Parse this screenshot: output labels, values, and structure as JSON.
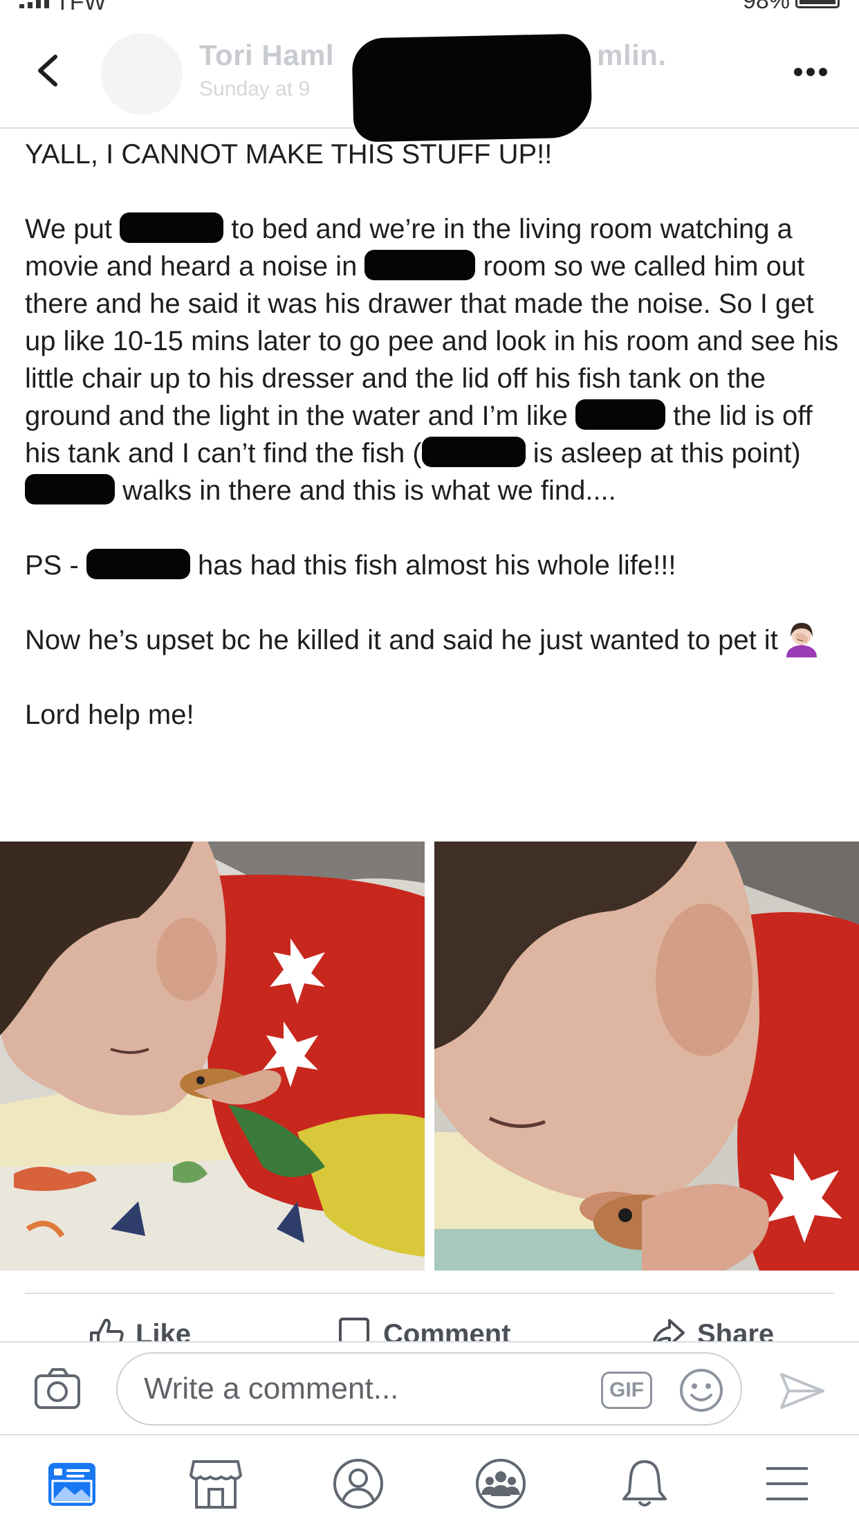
{
  "status_bar": {
    "carrier": "TFW",
    "battery": "98%"
  },
  "header": {
    "author": "Tori Haml",
    "author_suffix": "mlin.",
    "timestamp": "Sunday at 9"
  },
  "post": {
    "p1": "YALL, I CANNOT MAKE THIS STUFF UP!!",
    "p2_a": "We put ",
    "p2_b": " to bed and we’re in the living room watching a movie and heard a noise in ",
    "p2_c": " room so we called him out there and he said it was his drawer that made the noise. So I get up like 10-15 mins later to go pee and look in his room and see his little chair up to his dresser and the lid off his fish tank on the ground and the light in the water and I’m like ",
    "p2_d": " the lid is off his tank and I can’t find the fish (",
    "p2_e": " is asleep at this point) ",
    "p2_f": " walks in there and this is what we find....",
    "p3_a": "PS - ",
    "p3_b": " has had this fish almost his whole life!!!",
    "p4": "Now he’s upset bc he killed it and said he just wanted to pet it",
    "p5": "Lord help me!"
  },
  "actions": {
    "like": "Like",
    "comment": "Comment",
    "share": "Share"
  },
  "comment_bar": {
    "placeholder": "Write a comment...",
    "gif": "GIF"
  },
  "icons": {
    "back": "chevron-left-icon",
    "more": "more-horizontal-icon",
    "camera": "camera-icon",
    "sticker": "smiley-icon",
    "send": "send-icon",
    "news_feed": "news-feed-icon",
    "marketplace": "marketplace-icon",
    "profile": "profile-icon",
    "groups": "groups-icon",
    "notifications": "bell-icon",
    "menu": "menu-icon"
  },
  "colors": {
    "active_nav": "#1877f2",
    "text": "#1c1e21",
    "icon_gray": "#606770"
  }
}
